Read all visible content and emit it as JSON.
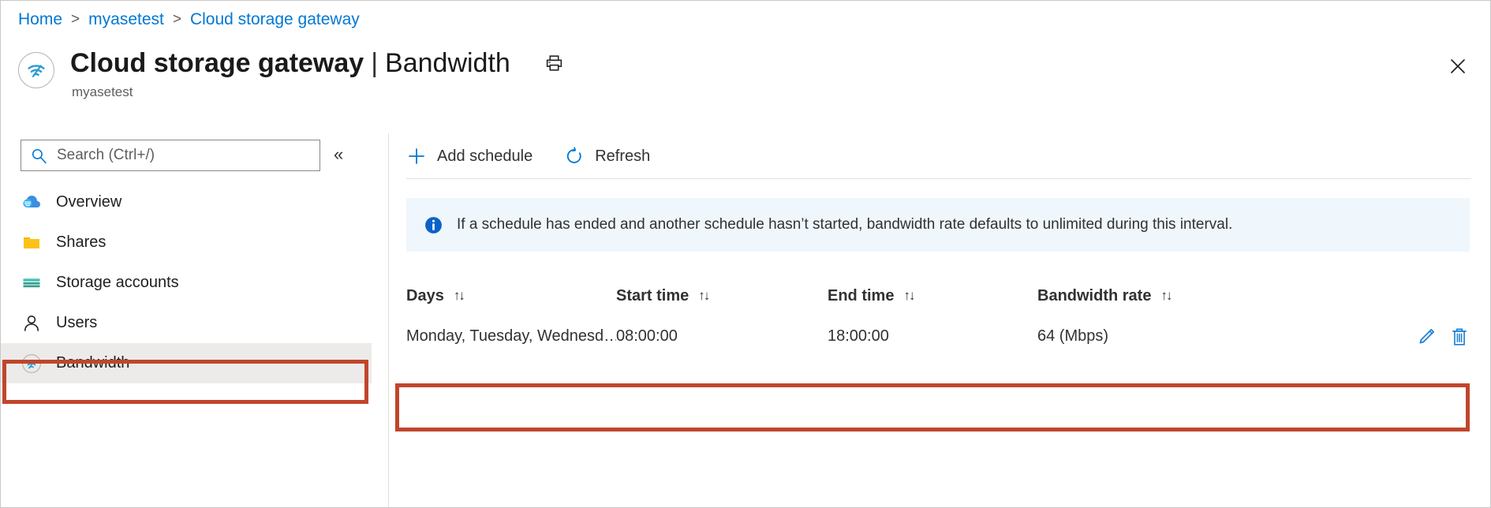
{
  "breadcrumb": {
    "items": [
      "Home",
      "myasetest",
      "Cloud storage gateway"
    ],
    "separator": ">"
  },
  "header": {
    "title_main": "Cloud storage gateway",
    "title_separator": "|",
    "title_sub": "Bandwidth",
    "subtitle": "myasetest",
    "resource_icon": "bandwidth-wifi-icon",
    "print_icon": "printer-icon",
    "close_icon": "close-icon"
  },
  "sidebar": {
    "search": {
      "placeholder": "Search (Ctrl+/)",
      "value": "",
      "icon": "search-icon"
    },
    "collapse_icon": "«",
    "items": [
      {
        "label": "Overview",
        "icon": "cloud-icon",
        "selected": false
      },
      {
        "label": "Shares",
        "icon": "folder-icon",
        "selected": false
      },
      {
        "label": "Storage accounts",
        "icon": "storage-account-icon",
        "selected": false
      },
      {
        "label": "Users",
        "icon": "user-icon",
        "selected": false
      },
      {
        "label": "Bandwidth",
        "icon": "bandwidth-wifi-icon",
        "selected": true
      }
    ]
  },
  "toolbar": {
    "commands": [
      {
        "label": "Add schedule",
        "icon": "plus-icon"
      },
      {
        "label": "Refresh",
        "icon": "refresh-icon"
      }
    ]
  },
  "info_banner": {
    "icon": "info-icon",
    "text": "If a schedule has ended and another schedule hasn’t started, bandwidth rate defaults to unlimited during this interval."
  },
  "table": {
    "sort_glyph": "↑↓",
    "columns": [
      {
        "label": "Days",
        "sortable": true
      },
      {
        "label": "Start time",
        "sortable": true
      },
      {
        "label": "End time",
        "sortable": true
      },
      {
        "label": "Bandwidth rate",
        "sortable": true
      }
    ],
    "rows": [
      {
        "days": "Monday, Tuesday, Wednesd…",
        "start_time": "08:00:00",
        "end_time": "18:00:00",
        "bandwidth_rate": "64 (Mbps)",
        "actions": [
          {
            "icon": "edit-pencil-icon"
          },
          {
            "icon": "delete-trash-icon"
          }
        ]
      }
    ]
  },
  "highlights": [
    {
      "name": "sidebar-bandwidth-highlight",
      "color": "#c0462c"
    },
    {
      "name": "schedule-row-highlight",
      "color": "#c0462c"
    }
  ],
  "colors": {
    "accent": "#0078d4",
    "highlight": "#c0462c",
    "info_bg": "#eff6fc",
    "selected_bg": "#edebe9"
  }
}
